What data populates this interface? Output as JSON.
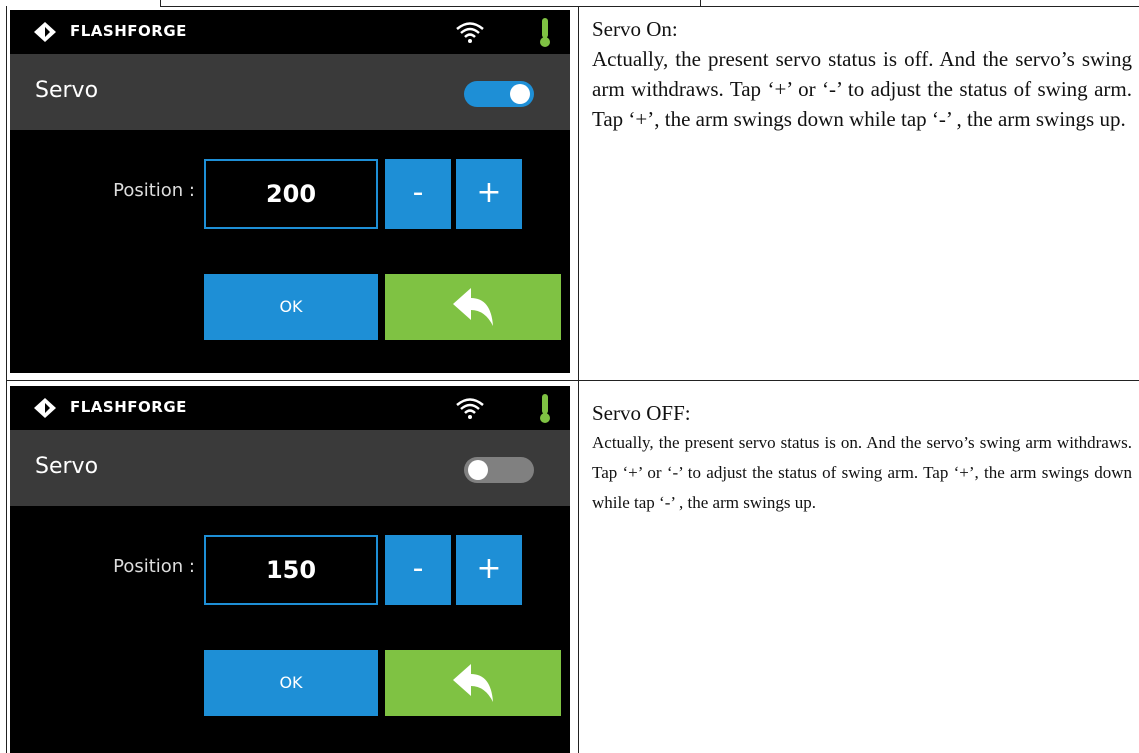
{
  "panels": [
    {
      "brand": "FLASHFORGE",
      "title": "Servo",
      "toggle_state": "on",
      "position_label": "Position :",
      "position_value": "200",
      "minus_label": "-",
      "plus_label": "+",
      "ok_label": "OK",
      "heading": "Servo On:",
      "description": "Actually, the present servo status is off. And the servo’s swing arm withdraws. Tap ‘+’ or ‘-’ to adjust the status of swing arm. Tap ‘+’, the arm swings down while tap ‘-’ , the arm swings up."
    },
    {
      "brand": "FLASHFORGE",
      "title": "Servo",
      "toggle_state": "off",
      "position_label": "Position :",
      "position_value": "150",
      "minus_label": "-",
      "plus_label": "+",
      "ok_label": "OK",
      "heading": "Servo OFF:",
      "description": "Actually, the present servo status is on. And the servo’s swing arm withdraws. Tap ‘+’ or ‘-’ to adjust the status of swing arm. Tap ‘+’, the arm swings down while tap ‘-’ , the arm swings up."
    }
  ],
  "colors": {
    "accent_blue": "#1e8fd6",
    "back_green": "#7fc243",
    "title_bar": "#3a3a3a",
    "screen_bg": "#000000"
  },
  "icons": {
    "logo": "flashforge-logo-icon",
    "wifi": "wifi-icon",
    "temperature": "thermometer-icon",
    "back": "back-arrow-icon"
  }
}
